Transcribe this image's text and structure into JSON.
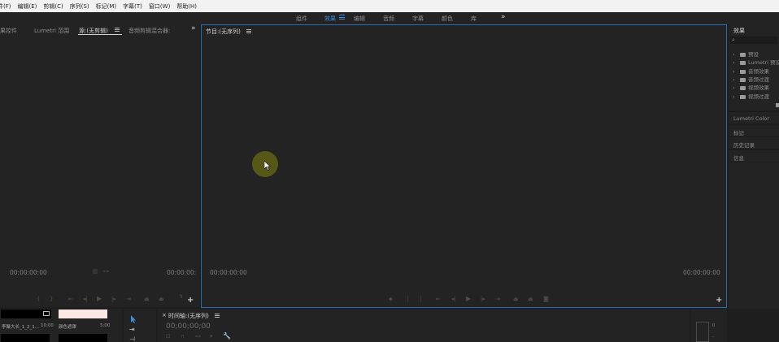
{
  "menubar": {
    "items": [
      "件(F)",
      "编辑(E)",
      "剪辑(C)",
      "序列(S)",
      "标记(M)",
      "字幕(T)",
      "窗口(W)",
      "帮助(H)"
    ]
  },
  "workspaces": {
    "tabs": [
      "组件",
      "效果",
      "编辑",
      "音频",
      "字幕",
      "颜色",
      "库"
    ],
    "active": "效果",
    "more": "»"
  },
  "source_panel": {
    "tabs": [
      "果控件",
      "Lumetri 范围",
      "源:(无剪辑)",
      "音频剪辑混合器:"
    ],
    "active_tab": "源:(无剪辑)",
    "more": "»",
    "timecode_left": "00:00:00:00",
    "timecode_right": "00:00:00:"
  },
  "program_panel": {
    "title": "节目:(无序列)",
    "timecode_left": "00:00:00:00",
    "timecode_right": "00:00:00:00",
    "add": "+"
  },
  "effects_panel": {
    "title": "效果",
    "items": [
      {
        "label": "预设",
        "icon": "folder-icon"
      },
      {
        "label": "Lumetri 预设",
        "icon": "folder-icon"
      },
      {
        "label": "音频效果",
        "icon": "folder-icon"
      },
      {
        "label": "音频过渡",
        "icon": "folder-icon"
      },
      {
        "label": "视频效果",
        "icon": "folder-icon"
      },
      {
        "label": "视频过渡",
        "icon": "folder-icon"
      }
    ],
    "sections": [
      "Lumetri Color",
      "标记",
      "历史记录",
      "信息"
    ]
  },
  "project_panel": {
    "items": [
      {
        "name": "李聚大长_1_2_1...",
        "duration": "10:00"
      },
      {
        "name": "颜色遮罩",
        "duration": "5:00"
      }
    ]
  },
  "timeline_panel": {
    "title": "时间轴:(无序列)",
    "timecode": "00;00;00;00"
  },
  "colors": {
    "accent": "#3d8ee0",
    "panel_bg": "#232323",
    "app_bg": "#1e1e1e",
    "menubar_bg": "#f2f2f2"
  }
}
